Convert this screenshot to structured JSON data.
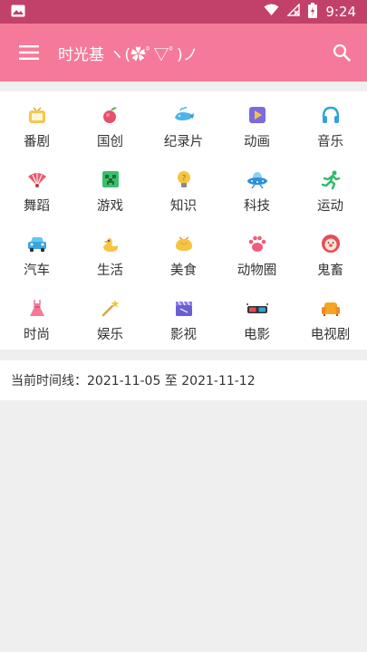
{
  "status_bar": {
    "time": "9:24",
    "icons": [
      "image-icon",
      "wifi-icon",
      "no-signal-icon",
      "battery-icon"
    ]
  },
  "app_bar": {
    "title": "时光基 ヽ(✿ﾟ▽ﾟ)ノ",
    "icons": [
      "hamburger-menu-icon",
      "search-icon"
    ]
  },
  "categories": [
    {
      "label": "番剧",
      "icon": "tv-icon"
    },
    {
      "label": "国创",
      "icon": "peach-icon"
    },
    {
      "label": "纪录片",
      "icon": "whale-icon"
    },
    {
      "label": "动画",
      "icon": "play-icon"
    },
    {
      "label": "音乐",
      "icon": "headphones-icon"
    },
    {
      "label": "舞蹈",
      "icon": "fan-icon"
    },
    {
      "label": "游戏",
      "icon": "creeper-icon"
    },
    {
      "label": "知识",
      "icon": "lightbulb-icon"
    },
    {
      "label": "科技",
      "icon": "ufo-icon"
    },
    {
      "label": "运动",
      "icon": "runner-icon"
    },
    {
      "label": "汽车",
      "icon": "car-icon"
    },
    {
      "label": "生活",
      "icon": "duck-icon"
    },
    {
      "label": "美食",
      "icon": "bun-icon"
    },
    {
      "label": "动物圈",
      "icon": "paw-icon"
    },
    {
      "label": "鬼畜",
      "icon": "clown-icon"
    },
    {
      "label": "时尚",
      "icon": "dress-icon"
    },
    {
      "label": "娱乐",
      "icon": "magic-wand-icon"
    },
    {
      "label": "影视",
      "icon": "clapperboard-icon"
    },
    {
      "label": "电影",
      "icon": "3d-glasses-icon"
    },
    {
      "label": "电视剧",
      "icon": "sofa-icon"
    }
  ],
  "timeline": {
    "text": "当前时间线：2021-11-05 至 2021-11-12"
  }
}
